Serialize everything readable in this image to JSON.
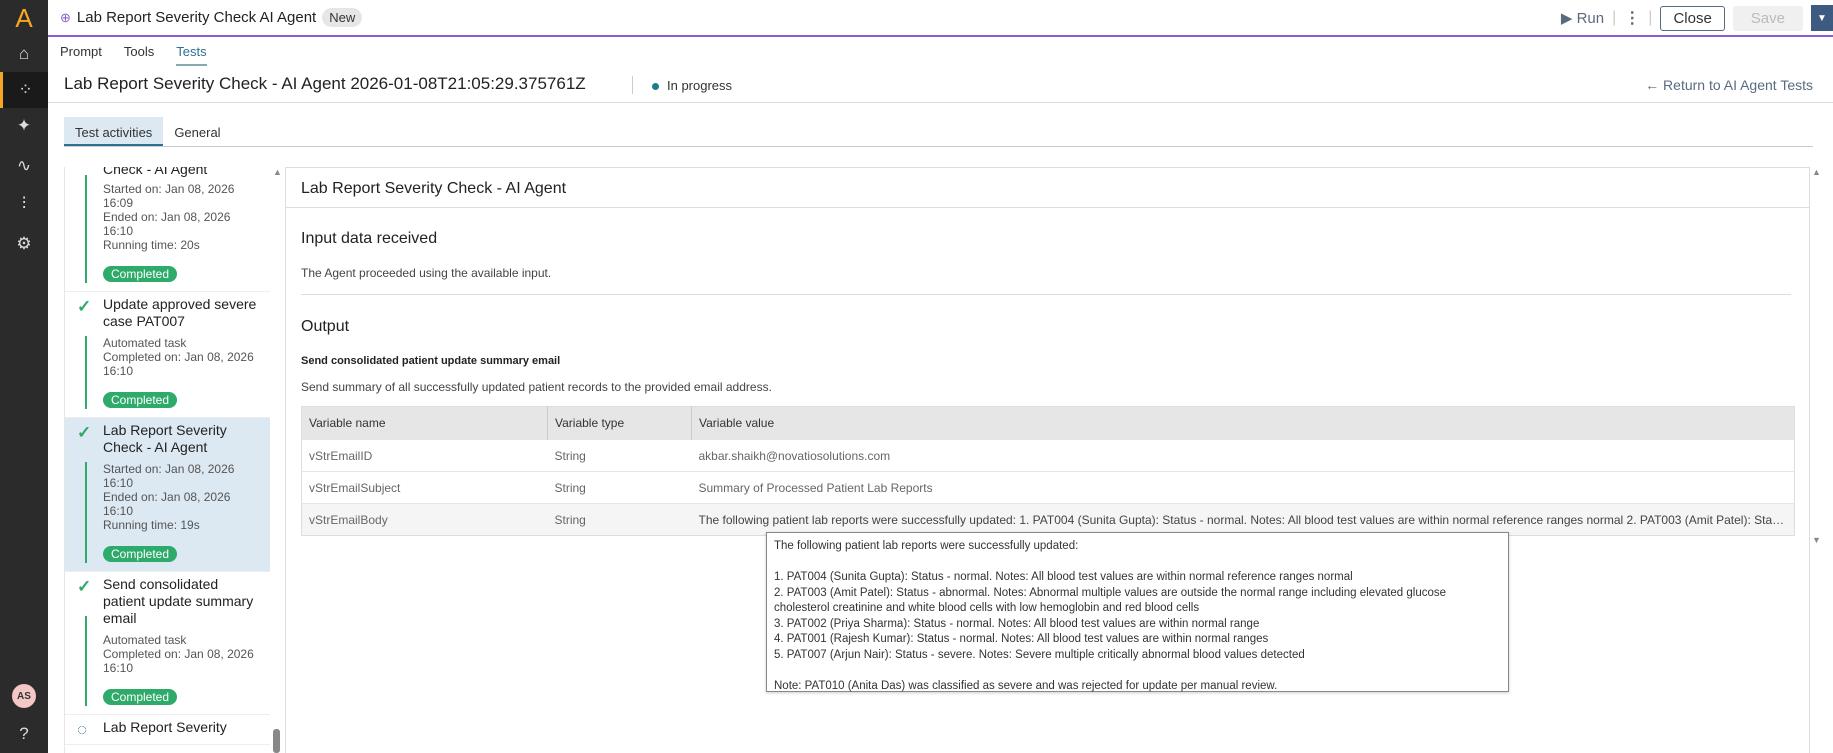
{
  "app": {
    "title": "Lab Report Severity Check AI Agent",
    "badge": "New",
    "user_initials": "AS"
  },
  "actions": {
    "run": "Run",
    "close": "Close",
    "save": "Save"
  },
  "nav_tabs": [
    "Prompt",
    "Tools",
    "Tests"
  ],
  "run": {
    "title": "Lab Report Severity Check - AI Agent 2026-01-08T21:05:29.375761Z",
    "status": "In progress",
    "return_link": "Return to AI Agent Tests"
  },
  "sub_tabs": [
    "Test activities",
    "General"
  ],
  "activities": [
    {
      "name": "Check - AI Agent",
      "meta": [
        "Started on: Jan 08, 2026",
        "16:09",
        "Ended on: Jan 08, 2026",
        "16:10",
        "Running time: 20s"
      ],
      "status": "Completed"
    },
    {
      "name": "Update approved severe case PAT007",
      "meta": [
        "Automated task",
        "Completed on: Jan 08, 2026",
        "16:10"
      ],
      "status": "Completed"
    },
    {
      "name": "Lab Report Severity Check - AI Agent",
      "meta": [
        "Started on: Jan 08, 2026",
        "16:10",
        "Ended on: Jan 08, 2026",
        "16:10",
        "Running time: 19s"
      ],
      "status": "Completed"
    },
    {
      "name": "Send consolidated patient update summary email",
      "meta": [
        "Automated task",
        "Completed on: Jan 08, 2026",
        "16:10"
      ],
      "status": "Completed"
    },
    {
      "name": "Lab Report Severity"
    }
  ],
  "panel": {
    "title": "Lab Report Severity Check - AI Agent",
    "input_heading": "Input data received",
    "input_text": "The Agent proceeded using the available input.",
    "output_heading": "Output",
    "task_label": "Send consolidated patient update summary email",
    "task_desc": "Send summary of all successfully updated patient records to the provided email address.",
    "columns": [
      "Variable name",
      "Variable type",
      "Variable value"
    ],
    "rows": [
      [
        "vStrEmailID",
        "String",
        "akbar.shaikh@novatiosolutions.com"
      ],
      [
        "vStrEmailSubject",
        "String",
        "Summary of Processed Patient Lab Reports"
      ],
      [
        "vStrEmailBody",
        "String",
        "The following patient lab reports were successfully updated: 1. PAT004 (Sunita Gupta): Status - normal. Notes: All blood test values are within normal reference ranges normal 2. PAT003 (Amit Patel): Status - abnormal. Notes: Abnormal multiple values are outside the normal range"
      ]
    ]
  },
  "tooltip": {
    "lines": [
      "The following patient lab reports were successfully updated:",
      "",
      "1. PAT004 (Sunita Gupta): Status - normal. Notes: All blood test values are within normal reference ranges normal",
      "2. PAT003 (Amit Patel): Status - abnormal. Notes: Abnormal multiple values are outside the normal range including elevated glucose cholesterol creatinine and white blood cells with low hemoglobin and red blood cells",
      "3. PAT002 (Priya Sharma): Status - normal. Notes: All blood test values are within normal range",
      "4. PAT001 (Rajesh Kumar): Status - normal. Notes: All blood test values are within normal ranges",
      "5. PAT007 (Arjun Nair): Status - severe. Notes: Severe multiple critically abnormal blood values detected",
      "",
      "Note: PAT010 (Anita Das) was classified as severe and was rejected for update per manual review."
    ]
  }
}
